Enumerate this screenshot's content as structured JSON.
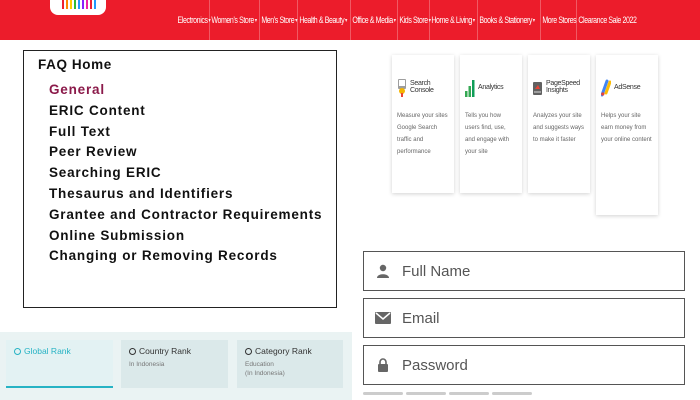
{
  "nav": {
    "items": [
      {
        "label": "Electronics",
        "chevron": true
      },
      {
        "label": "Women's Store",
        "chevron": true
      },
      {
        "label": "Men's Store",
        "chevron": true
      },
      {
        "label": "Health & Beauty",
        "chevron": true
      },
      {
        "label": "Office & Media",
        "chevron": true
      },
      {
        "label": "Kids Store",
        "chevron": true
      },
      {
        "label": "Home & Living",
        "chevron": true
      },
      {
        "label": "Books & Stationery",
        "chevron": true
      },
      {
        "label": "More Stores",
        "chevron": false
      },
      {
        "label": "Clearance Sale 2022",
        "chevron": false
      }
    ],
    "bg_color": "#ec1c2b"
  },
  "faq": {
    "title": "FAQ Home",
    "links": [
      "General",
      "ERIC Content",
      "Full Text",
      "Peer Review",
      "Searching ERIC",
      "Thesaurus and Identifiers",
      "Grantee and Contractor Requirements",
      "Online Submission",
      "Changing or Removing Records"
    ],
    "active_index": 0
  },
  "ranks": {
    "global": {
      "title": "Global Rank"
    },
    "country": {
      "title": "Country Rank",
      "sub": "In Indonesia"
    },
    "category": {
      "title": "Category Rank",
      "sub1": "Education",
      "sub2": "(In Indonesia)"
    }
  },
  "tools": [
    {
      "name": "Search Console",
      "desc": "Measure your sites Google Search traffic and performance",
      "icon": "search-console-icon"
    },
    {
      "name": "Analytics",
      "desc": "Tells you how users find, use, and engage with your site",
      "icon": "analytics-icon"
    },
    {
      "name": "PageSpeed Insights",
      "desc": "Analyzes your site and suggests ways to make it faster",
      "icon": "pagespeed-icon"
    },
    {
      "name": "AdSense",
      "desc": "Helps your site earn money from your online content",
      "icon": "adsense-icon"
    }
  ],
  "form": {
    "full_name_placeholder": "Full Name",
    "email_placeholder": "Email",
    "password_placeholder": "Password"
  },
  "colors": {
    "accent_teal": "#27b3c4",
    "active_link": "#8b1a4a"
  }
}
